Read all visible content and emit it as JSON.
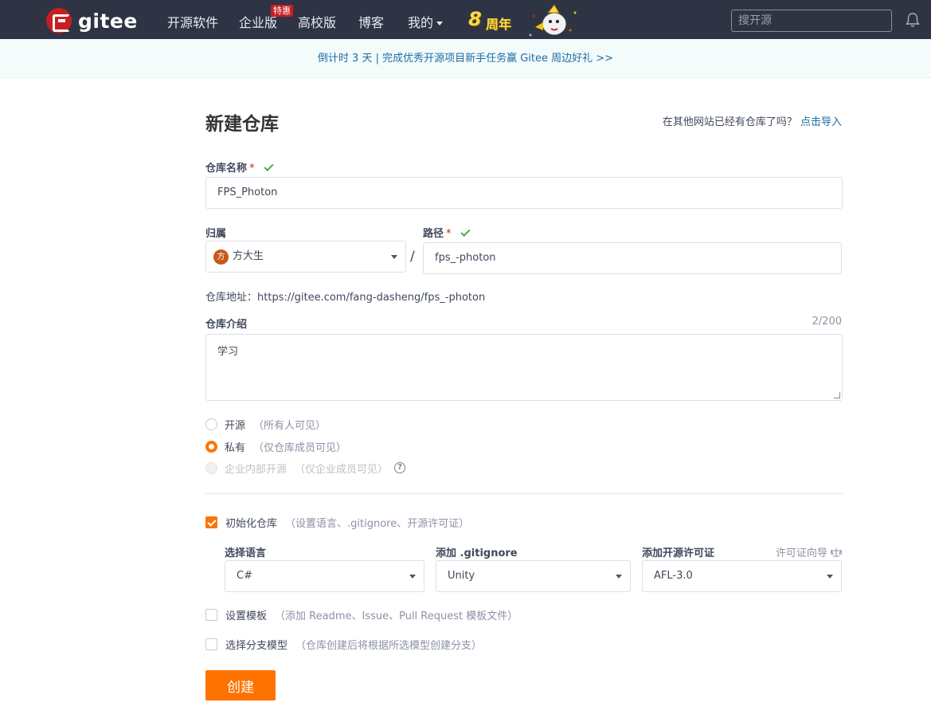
{
  "navbar": {
    "logo_text": "gitee",
    "items": [
      {
        "label": "开源软件"
      },
      {
        "label": "企业版"
      },
      {
        "label": "高校版"
      },
      {
        "label": "博客"
      },
      {
        "label": "我的"
      }
    ],
    "hot_badge": "特惠",
    "anniversary_number": "8",
    "anniversary_text": "周年",
    "search_placeholder": "搜开源"
  },
  "banner": {
    "text": "倒计时 3 天 | 完成优秀开源项目新手任务赢 Gitee 周边好礼 >>"
  },
  "form": {
    "title": "新建仓库",
    "import_prompt": "在其他网站已经有仓库了吗？",
    "import_link": "点击导入",
    "repo_name_label": "仓库名称",
    "required_mark": "*",
    "repo_name_value": "FPS_Photon",
    "owner_label": "归属",
    "owner_avatar_char": "方",
    "owner_value": "方大生",
    "separator": "/",
    "path_label": "路径",
    "path_value": "fps_-photon",
    "repo_url_label": "仓库地址：",
    "repo_url_value": "https://gitee.com/fang-dasheng/fps_-photon",
    "intro_label": "仓库介绍",
    "intro_counter": "2/200",
    "intro_value": "学习",
    "visibility": [
      {
        "label": "开源",
        "hint": "（所有人可见）",
        "selected": false,
        "disabled": false
      },
      {
        "label": "私有",
        "hint": "（仅仓库成员可见）",
        "selected": true,
        "disabled": false
      },
      {
        "label": "企业内部开源",
        "hint": "（仅企业成员可见）",
        "selected": false,
        "disabled": true
      }
    ],
    "help_mark": "?",
    "init_repo": {
      "label": "初始化仓库",
      "hint": "（设置语言、.gitignore、开源许可证）",
      "checked": true
    },
    "language_label": "选择语言",
    "language_value": "C#",
    "gitignore_label": "添加 .gitignore",
    "gitignore_value": "Unity",
    "license_label": "添加开源许可证",
    "license_guide": "许可证向导",
    "license_value": "AFL-3.0",
    "template": {
      "label": "设置模板",
      "hint": "（添加 Readme、Issue、Pull Request 模板文件）",
      "checked": false
    },
    "branch_model": {
      "label": "选择分支模型",
      "hint": "（仓库创建后将根据所选模型创建分支）",
      "checked": false
    },
    "submit_label": "创建"
  },
  "colors": {
    "navbar_bg": "#2e3444",
    "accent_orange": "#fe7300",
    "brand_red": "#c71d23",
    "link_blue": "#1b6ea5",
    "success_green": "#3eaf51"
  }
}
